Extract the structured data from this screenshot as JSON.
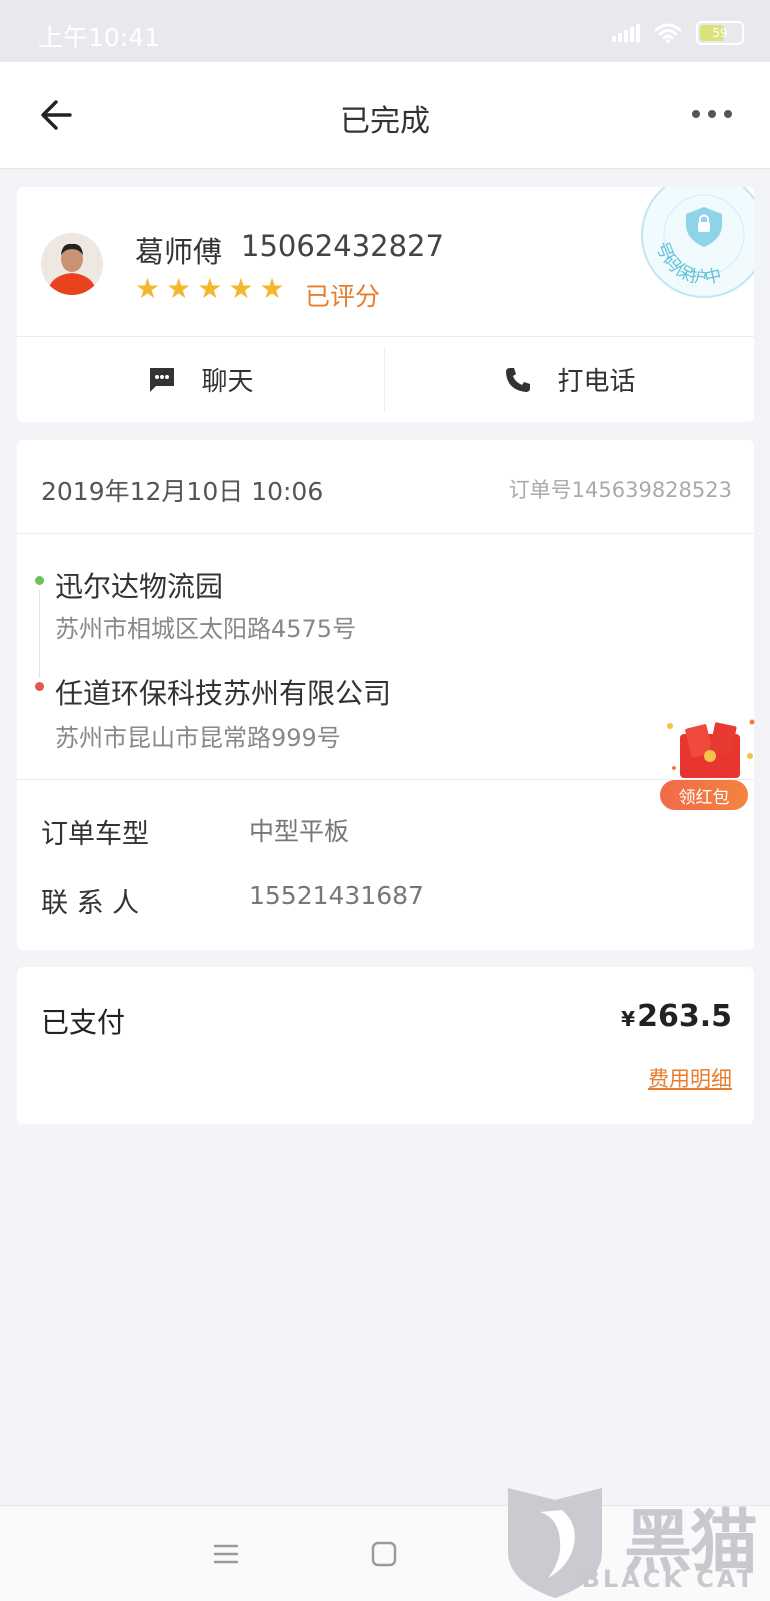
{
  "status_bar": {
    "time": "上午10:41",
    "battery": "59"
  },
  "nav": {
    "title": "已完成"
  },
  "driver": {
    "name": "葛师傅",
    "phone": "15062432827",
    "stars": 5,
    "rated_label": "已评分",
    "protect_stamp": "号码保护中",
    "chat_label": "聊天",
    "call_label": "打电话"
  },
  "order": {
    "datetime": "2019年12月10日 10:06",
    "order_no": "订单号145639828523",
    "from": {
      "name": "迅尔达物流园",
      "address": "苏州市相城区太阳路4575号"
    },
    "to": {
      "name": "任道环保科技苏州有限公司",
      "address": "苏州市昆山市昆常路999号"
    },
    "vehicle_label": "订单车型",
    "vehicle_value": "中型平板",
    "contact_label": "联 系 人",
    "contact_value": "15521431687",
    "redpack_label": "领红包"
  },
  "payment": {
    "label": "已支付",
    "currency": "¥",
    "amount": "263.5",
    "detail_link": "费用明细"
  },
  "watermark": {
    "cn": "黑猫",
    "en": "BLACK CAT"
  },
  "colors": {
    "accent_orange": "#e87d2c",
    "star": "#f4b82e",
    "dot_start": "#6cc05a",
    "dot_end": "#e2574b"
  }
}
